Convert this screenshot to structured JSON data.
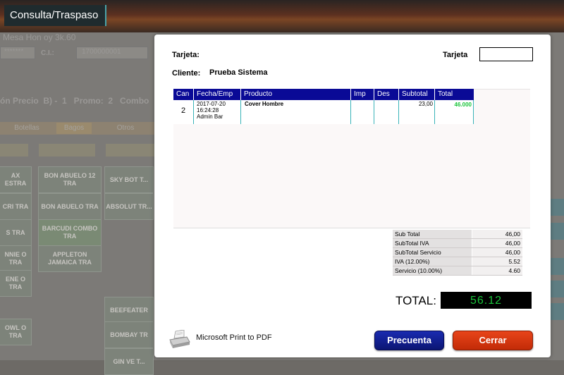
{
  "app": {
    "title": "Consulta/Traspaso"
  },
  "background": {
    "line1": "Mesa  Hon oy 3k.60",
    "line2_left": "*******",
    "line2_ci": "C.I.:",
    "line2_ci_value": "1700000001",
    "line3": "ón Precio  B) -  1   Promo:  2   Combo",
    "tabs": [
      "Botellas",
      "Bagos",
      "Otros"
    ],
    "tiles": [
      "BON ABUELO 12 TRA",
      "SKY BOT T...",
      "BON ABUELO TRA",
      "ABSOLUT TR...",
      "BARCUDI COMBO TRA",
      "APPLETON JAMAICA TRA",
      "BEEFEATER",
      "BOMBAY TR",
      "GIN VE T..."
    ],
    "tiles_left": [
      "AX ESTRA",
      "CRI TRA",
      "S TRA",
      "NNIE O TRA",
      "ENE O TRA",
      "OWL O TRA"
    ]
  },
  "dialog": {
    "tarjeta_label": "Tarjeta:",
    "tarjeta_right_label": "Tarjeta",
    "tarjeta_input": "",
    "cliente_label": "Cliente:",
    "cliente_value": "Prueba Sistema",
    "table": {
      "headers": [
        "Can",
        "Fecha/Emp",
        "Producto",
        "Imp",
        "Des",
        "Subtotal",
        "Total"
      ],
      "rows": [
        {
          "can": "2",
          "fecha": "2017-07-20",
          "hora": "16:24:28",
          "emp": "Admin Bar",
          "producto": "Cover Hombre",
          "imp": "",
          "des": "",
          "subtotal": "23,00",
          "total": "46.000"
        }
      ]
    },
    "summary": [
      {
        "label": "Sub Total",
        "value": "46,00"
      },
      {
        "label": "SubTotal IVA",
        "value": "46,00"
      },
      {
        "label": "SubTotal Servicio",
        "value": "46,00"
      },
      {
        "label": "IVA (12.00%)",
        "value": "5.52"
      },
      {
        "label": "Servicio (10.00%)",
        "value": "4.60"
      }
    ],
    "total_label": "TOTAL:",
    "total_value": "56.12",
    "printer": "Microsoft Print to PDF",
    "buttons": {
      "recuenta": "Precuenta",
      "cerrar": "Cerrar"
    }
  },
  "colors": {
    "header_blue": "#0a0a96",
    "total_green": "#19c43a",
    "accent_red": "#d9380f",
    "accent_navy": "#0b1573"
  }
}
